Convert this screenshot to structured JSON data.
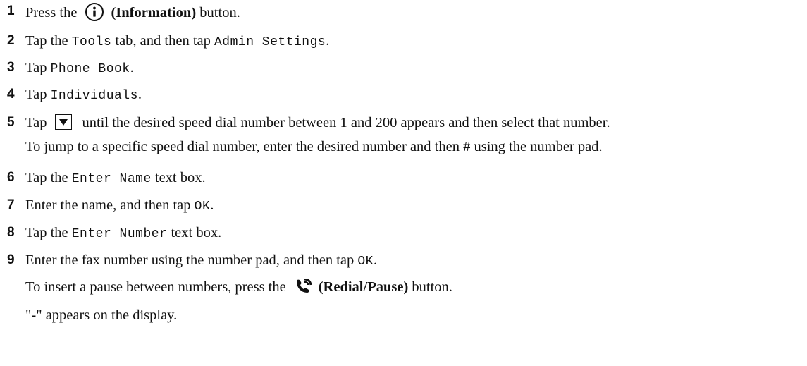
{
  "steps": [
    {
      "num": "1",
      "parts": [
        "Press the",
        "(Information)",
        "button."
      ],
      "icon": "info-icon"
    },
    {
      "num": "2",
      "parts": [
        "Tap the ",
        "Tools",
        " tab, and then tap ",
        "Admin Settings",
        "."
      ]
    },
    {
      "num": "3",
      "parts": [
        "Tap ",
        "Phone Book",
        "."
      ]
    },
    {
      "num": "4",
      "parts": [
        "Tap ",
        "Individuals",
        "."
      ]
    },
    {
      "num": "5",
      "parts": [
        "Tap",
        "until the desired speed dial number between 1 and 200 appears and then select that number."
      ],
      "icon": "down-arrow-icon",
      "note": "To jump to a specific speed dial number, enter the desired number and then # using the number pad."
    },
    {
      "num": "6",
      "parts": [
        "Tap the ",
        "Enter Name",
        " text box."
      ]
    },
    {
      "num": "7",
      "parts": [
        "Enter the name, and then tap ",
        "OK",
        "."
      ]
    },
    {
      "num": "8",
      "parts": [
        "Tap the ",
        "Enter Number",
        " text box."
      ]
    },
    {
      "num": "9",
      "parts": [
        "Enter the fax number using the number pad, and then tap ",
        "OK",
        "."
      ],
      "note1_parts": [
        "To insert a pause between numbers, press the",
        "(Redial/Pause)",
        "button."
      ],
      "note2": "\"-\" appears on the display.",
      "icon": "redial-pause-icon"
    }
  ]
}
